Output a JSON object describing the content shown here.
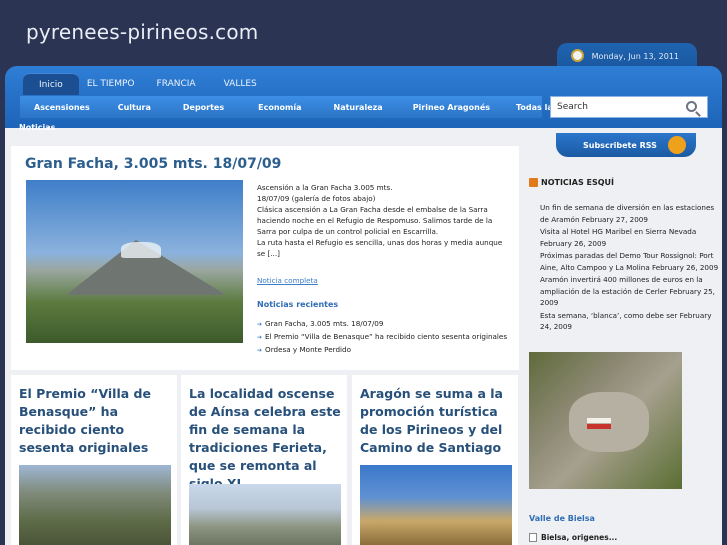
{
  "site": {
    "title": "pyrenees-pirineos.com",
    "date": "Monday, Jun 13, 2011"
  },
  "nav": {
    "tabs": [
      {
        "label": "Inicio"
      },
      {
        "label": "EL TIEMPO"
      },
      {
        "label": "FRANCIA"
      },
      {
        "label": "VALLES"
      }
    ],
    "categories": [
      {
        "label": "Ascensiones"
      },
      {
        "label": "Cultura"
      },
      {
        "label": "Deportes"
      },
      {
        "label": "Economía"
      },
      {
        "label": "Naturaleza"
      },
      {
        "label": "Pirineo Aragonés"
      },
      {
        "label": "Todas las"
      }
    ],
    "categories_overflow": "Noticias",
    "search_placeholder": "Search",
    "rss_label": "Subscribete RSS"
  },
  "feature": {
    "title": "Gran Facha, 3.005 mts. 18/07/09",
    "text": [
      "Ascensión a la Gran Facha 3.005 mts.",
      "18/07/09 (galería de fotos abajo)",
      "Clásica ascensión a La Gran Facha desde el embalse de la Sarra haciendo noche en el Refugio de Respomuso. Salimos tarde de la Sarra por culpa de un control policial en Escarrilla.",
      "La ruta hasta el Refugio es sencilla, unas dos horas y media aunque se [...]"
    ],
    "more_link": "Noticia completa",
    "recent_title": "Noticias recientes",
    "recent": [
      "Gran Facha, 3.005 mts. 18/07/09",
      "El Premio “Villa de Benasque” ha recibido ciento sesenta originales",
      "Ordesa y Monte Perdido"
    ]
  },
  "cards": [
    {
      "title": "El Premio “Villa de Benasque” ha recibido ciento sesenta originales"
    },
    {
      "title": "La localidad oscense de Aínsa celebra este fin de semana la tradiciones Ferieta, que se remonta al siglo XI"
    },
    {
      "title": "Aragón se suma a la promoción turística de los Pirineos y del Camino de Santiago"
    }
  ],
  "sidebar": {
    "heading": "NOTICIAS ESQUÍ",
    "news": [
      "Un fin de semana de diversión en las estaciones de Aramón February 27, 2009",
      "Visita al Hotel HG Maribel en Sierra Nevada February 26, 2009",
      "Próximas paradas del Demo Tour Rossignol: Port Aine, Alto Campoo y La Molina February 26, 2009",
      "Aramón invertirá 400 millones de euros en la ampliación de la estación de Cerler February 25, 2009",
      "Esta semana, ‘blanca’, como debe ser February 24, 2009"
    ],
    "valle_title": "Valle de Bielsa",
    "valle_item": "Bielsa, origenes..."
  }
}
